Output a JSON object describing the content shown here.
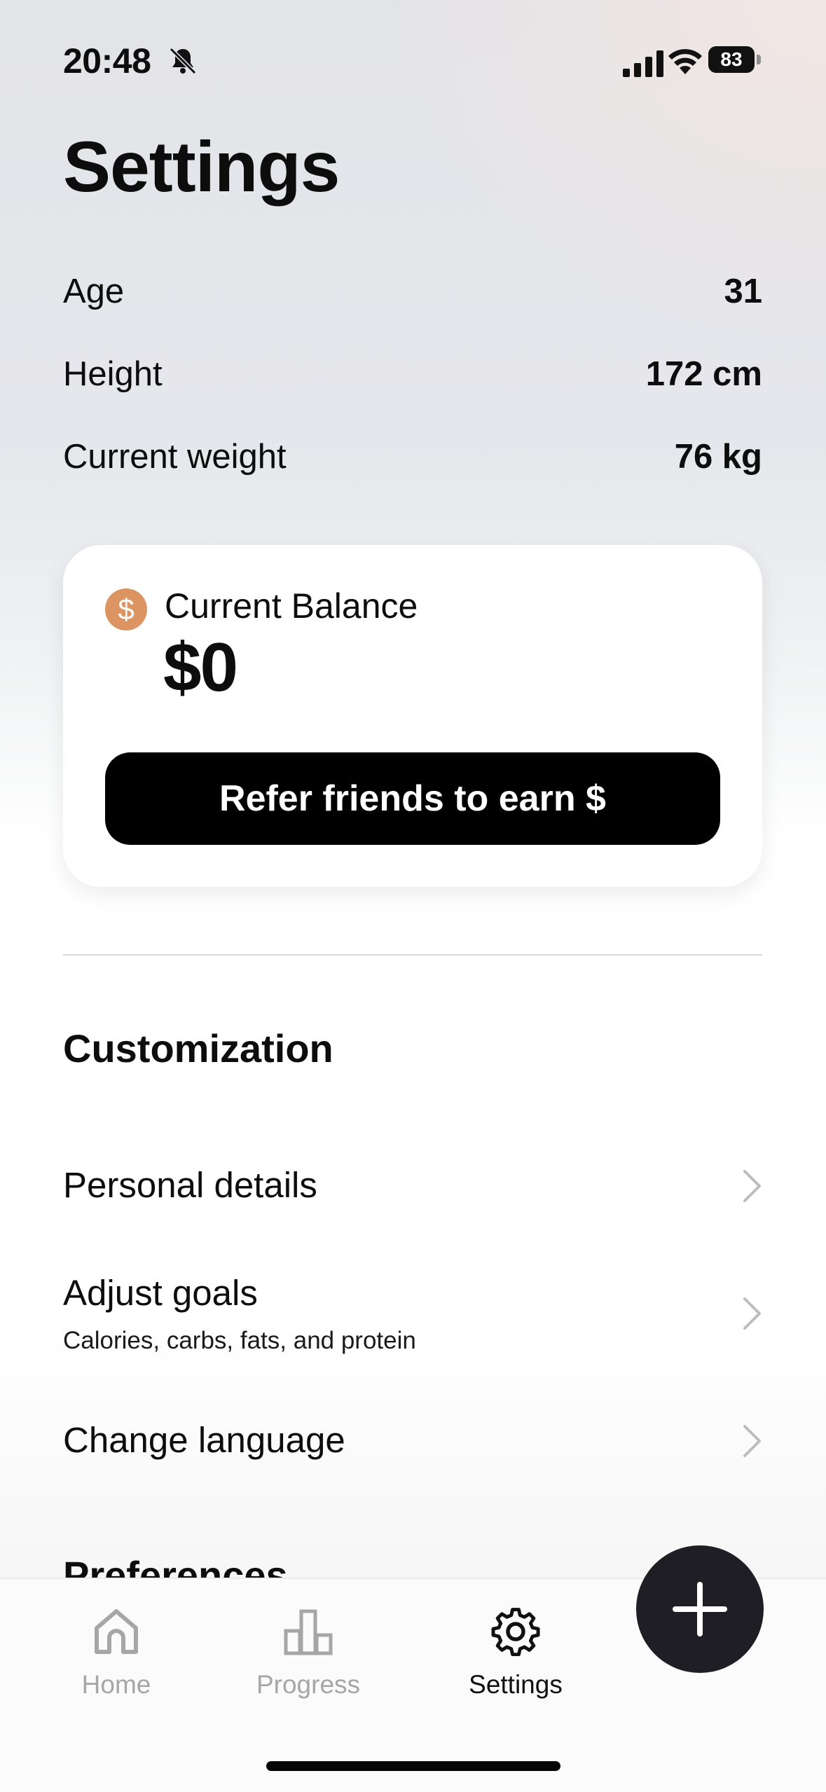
{
  "status_bar": {
    "time": "20:48",
    "battery": "83"
  },
  "page": {
    "title": "Settings"
  },
  "stats": [
    {
      "label": "Age",
      "value": "31"
    },
    {
      "label": "Height",
      "value": "172 cm"
    },
    {
      "label": "Current weight",
      "value": "76 kg"
    }
  ],
  "balance_card": {
    "coin_symbol": "$",
    "label": "Current Balance",
    "amount": "$0",
    "refer_button": "Refer friends to earn $"
  },
  "customization": {
    "title": "Customization",
    "items": [
      {
        "label": "Personal details",
        "subtitle": ""
      },
      {
        "label": "Adjust goals",
        "subtitle": "Calories, carbs, fats, and protein"
      },
      {
        "label": "Change language",
        "subtitle": ""
      }
    ]
  },
  "preferences": {
    "title": "Preferences"
  },
  "tabbar": {
    "tabs": [
      {
        "label": "Home"
      },
      {
        "label": "Progress"
      },
      {
        "label": "Settings"
      }
    ]
  },
  "colors": {
    "coin": "#dc9463",
    "fab": "#1e1e24",
    "button": "#000000"
  }
}
